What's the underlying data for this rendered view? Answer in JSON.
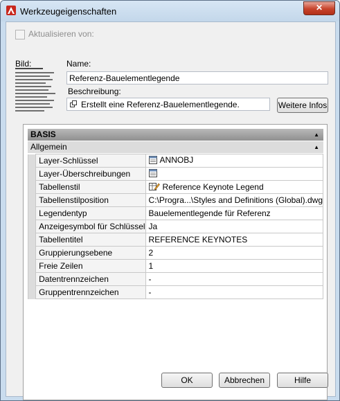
{
  "window": {
    "title": "Werkzeugeigenschaften",
    "close_glyph": "✕",
    "app_icon": "autocad-icon"
  },
  "update_from": {
    "label": "Aktualisieren von:",
    "checked": false
  },
  "image": {
    "label": "Bild:"
  },
  "name": {
    "label": "Name:",
    "value": "Referenz-Bauelementlegende"
  },
  "description": {
    "label": "Beschreibung:",
    "value": "Erstellt eine Referenz-Bauelementlegende.",
    "more_info_button": "Weitere Infos"
  },
  "properties": {
    "category": "BASIS",
    "subcategory": "Allgemein",
    "rows": [
      {
        "name": "Layer-Schlüssel",
        "value": "ANNOBJ",
        "icon": "layer-key-icon"
      },
      {
        "name": "Layer-Überschreibungen",
        "value": "",
        "icon": "layer-override-icon"
      },
      {
        "name": "Tabellenstil",
        "value": "Reference Keynote Legend",
        "icon": "table-style-icon"
      },
      {
        "name": "Tabellenstilposition",
        "value": "C:\\Progra...\\Styles and Definitions (Global).dwg",
        "icon": ""
      },
      {
        "name": "Legendentyp",
        "value": "Bauelementlegende für Referenz",
        "icon": ""
      },
      {
        "name": "Anzeigesymbol für Schlüssel",
        "value": "Ja",
        "icon": ""
      },
      {
        "name": "Tabellentitel",
        "value": "REFERENCE KEYNOTES",
        "icon": ""
      },
      {
        "name": "Gruppierungsebene",
        "value": "2",
        "icon": ""
      },
      {
        "name": "Freie Zeilen",
        "value": "1",
        "icon": ""
      },
      {
        "name": "Datentrennzeichen",
        "value": " -",
        "icon": ""
      },
      {
        "name": "Gruppentrennzeichen",
        "value": " -",
        "icon": ""
      }
    ]
  },
  "buttons": {
    "ok": "OK",
    "cancel": "Abbrechen",
    "help": "Hilfe"
  }
}
